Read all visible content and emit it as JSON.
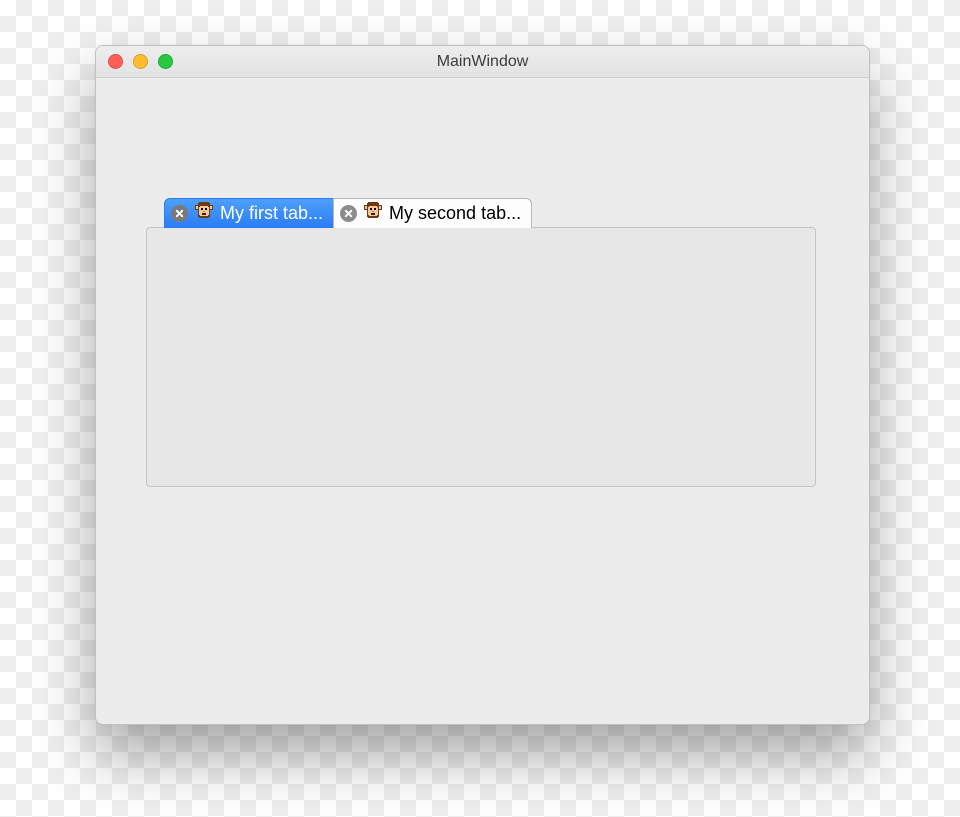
{
  "window": {
    "title": "MainWindow"
  },
  "tabs": [
    {
      "label": "My first tab...",
      "icon": "monkey-icon",
      "active": true
    },
    {
      "label": "My second tab...",
      "icon": "monkey-icon",
      "active": false
    }
  ]
}
